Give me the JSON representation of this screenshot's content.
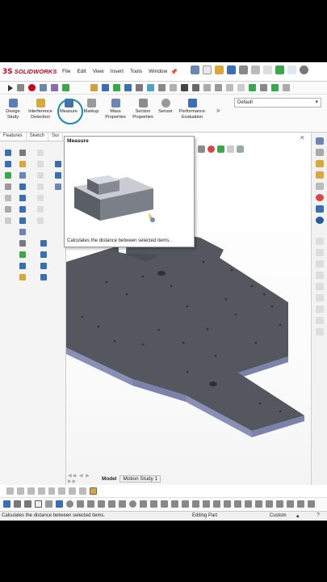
{
  "app": {
    "ds_mark": "3S",
    "name": "SOLIDWORKS"
  },
  "menu": {
    "items": [
      "File",
      "Edit",
      "View",
      "Insert",
      "Tools",
      "Window"
    ],
    "pin_icon": "pin-icon"
  },
  "commands": {
    "design_study": "Design Study",
    "interference_detection": "Interference Detection",
    "measure": "Measure",
    "markup": "Markup",
    "mass_properties": "Mass Properties",
    "section_properties": "Section Properties",
    "sensor": "Sensor",
    "performance_evaluation": "Performance Evaluation",
    "overflow": "»"
  },
  "configuration": {
    "selected": "Default"
  },
  "tabs": {
    "features": "Features",
    "sketch": "Sketch",
    "surfaces": "Sur"
  },
  "tooltip": {
    "title": "Measure",
    "description": "Calculates the distance between selected items."
  },
  "bottom_tabs": {
    "arrows": "◀◀ ◀ ▶ ▶▶",
    "model": "Model",
    "motion_study": "Motion Study 1"
  },
  "status": {
    "message": "Calculates the distance between selected items.",
    "mode": "Editing Part",
    "units": "Custom"
  },
  "colors": {
    "brand_red": "#d0021b",
    "highlight_ring": "#1c8ab3",
    "part_top": "#54575e",
    "part_side": "#8a8fb8"
  }
}
